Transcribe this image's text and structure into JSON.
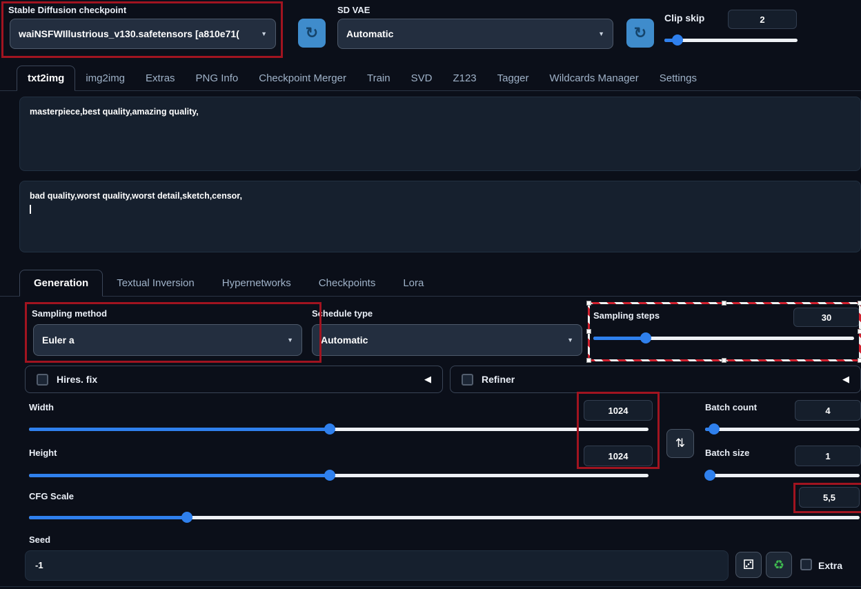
{
  "colors": {
    "background": "#0b0f19",
    "accent_blue": "#2f80ed",
    "annotation_red": "#a11420",
    "refresh_button_blue": "#3f8ccc",
    "recycle_green": "#3fb950"
  },
  "icons": {
    "refresh": "↻",
    "dropdown_arrow": "▼",
    "collapse_left": "◀",
    "swap_axes": "⇅",
    "dice": "⚂",
    "recycle": "♻"
  },
  "header": {
    "checkpoint_label": "Stable Diffusion checkpoint",
    "checkpoint_value": "waiNSFWIllustrious_v130.safetensors [a810e71(",
    "sd_vae_label": "SD VAE",
    "sd_vae_value": "Automatic",
    "clip_skip_label": "Clip skip",
    "clip_skip_value": "2"
  },
  "main_tabs": [
    {
      "label": "txt2img",
      "active": true
    },
    {
      "label": "img2img",
      "active": false
    },
    {
      "label": "Extras",
      "active": false
    },
    {
      "label": "PNG Info",
      "active": false
    },
    {
      "label": "Checkpoint Merger",
      "active": false
    },
    {
      "label": "Train",
      "active": false
    },
    {
      "label": "SVD",
      "active": false
    },
    {
      "label": "Z123",
      "active": false
    },
    {
      "label": "Tagger",
      "active": false
    },
    {
      "label": "Wildcards Manager",
      "active": false
    },
    {
      "label": "Settings",
      "active": false
    }
  ],
  "prompt": "masterpiece,best quality,amazing quality,",
  "negative_prompt": "bad quality,worst quality,worst detail,sketch,censor,",
  "sub_tabs": [
    {
      "label": "Generation",
      "active": true
    },
    {
      "label": "Textual Inversion",
      "active": false
    },
    {
      "label": "Hypernetworks",
      "active": false
    },
    {
      "label": "Checkpoints",
      "active": false
    },
    {
      "label": "Lora",
      "active": false
    }
  ],
  "generation": {
    "sampling_method_label": "Sampling method",
    "sampling_method_value": "Euler a",
    "schedule_type_label": "Schedule type",
    "schedule_type_value": "Automatic",
    "sampling_steps_label": "Sampling steps",
    "sampling_steps_value": "30",
    "hires_fix_label": "Hires. fix",
    "refiner_label": "Refiner",
    "width_label": "Width",
    "width_value": "1024",
    "height_label": "Height",
    "height_value": "1024",
    "batch_count_label": "Batch count",
    "batch_count_value": "4",
    "batch_size_label": "Batch size",
    "batch_size_value": "1",
    "cfg_label": "CFG Scale",
    "cfg_value": "5,5",
    "seed_label": "Seed",
    "seed_value": "-1",
    "extra_label": "Extra"
  },
  "slider_positions": {
    "clip_skip": 10,
    "sampling_steps": 20,
    "width": 48.5,
    "height": 48.5,
    "batch_count": 6,
    "batch_size": 3,
    "cfg": 19
  }
}
